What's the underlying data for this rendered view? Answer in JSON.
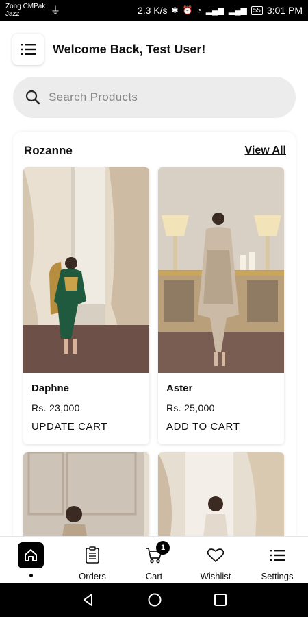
{
  "status_bar": {
    "carrier_line1": "Zong CMPak",
    "carrier_line2": "Jazz",
    "speed": "2.3 K/s",
    "battery": "55",
    "time": "3:01 PM"
  },
  "header": {
    "welcome": "Welcome Back, Test User!"
  },
  "search": {
    "placeholder": "Search Products"
  },
  "collection": {
    "title": "Rozanne",
    "view_all": "View All",
    "products": [
      {
        "name": "Daphne",
        "price": "Rs. 23,000",
        "action": "UPDATE CART"
      },
      {
        "name": "Aster",
        "price": "Rs. 25,000",
        "action": "ADD TO CART"
      }
    ]
  },
  "bottom_nav": {
    "items": [
      {
        "label": "",
        "icon": "home-icon"
      },
      {
        "label": "Orders",
        "icon": "orders-icon"
      },
      {
        "label": "Cart",
        "icon": "cart-icon"
      },
      {
        "label": "Wishlist",
        "icon": "heart-icon"
      },
      {
        "label": "Settings",
        "icon": "settings-icon"
      }
    ],
    "cart_badge": "1"
  },
  "colors": {
    "accent": "#000000",
    "search_bg": "#ececec"
  }
}
